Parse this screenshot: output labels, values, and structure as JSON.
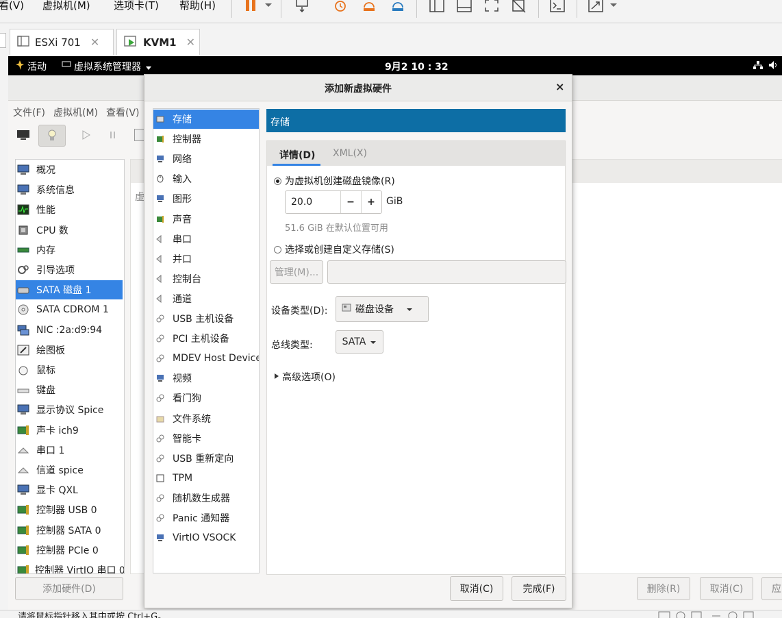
{
  "vmware": {
    "menus": [
      "看(V)",
      "虚拟机(M)",
      "选项卡(T)",
      "帮助(H)"
    ],
    "tabs": [
      {
        "label": "ESXi 701",
        "active": false
      },
      {
        "label": "KVM1",
        "active": true
      }
    ],
    "status_text": "请将鼠标指针移入其中或按 Ctrl+G。"
  },
  "gnome": {
    "activities": "活动",
    "app_menu": "虚拟系统管理器",
    "clock": "9月2 10 : 32"
  },
  "virt_manager": {
    "menus": [
      "文件(F)",
      "虚拟机(M)",
      "查看(V)"
    ],
    "sidebar": [
      {
        "label": "概况",
        "icon": "monitor-icon"
      },
      {
        "label": "系统信息",
        "icon": "monitor-icon"
      },
      {
        "label": "性能",
        "icon": "performance-icon"
      },
      {
        "label": "CPU 数",
        "icon": "cpu-icon"
      },
      {
        "label": "内存",
        "icon": "memory-icon"
      },
      {
        "label": "引导选项",
        "icon": "boot-options-icon"
      },
      {
        "label": "SATA 磁盘 1",
        "icon": "disk-icon",
        "selected": true
      },
      {
        "label": "SATA CDROM 1",
        "icon": "cdrom-icon"
      },
      {
        "label": "NIC :2a:d9:94",
        "icon": "network-icon"
      },
      {
        "label": "绘图板",
        "icon": "tablet-icon"
      },
      {
        "label": "鼠标",
        "icon": "mouse-icon"
      },
      {
        "label": "键盘",
        "icon": "keyboard-icon"
      },
      {
        "label": "显示协议 Spice",
        "icon": "monitor-icon"
      },
      {
        "label": "声卡 ich9",
        "icon": "sound-card-icon"
      },
      {
        "label": "串口 1",
        "icon": "serial-icon"
      },
      {
        "label": "信道 spice",
        "icon": "serial-icon"
      },
      {
        "label": "显卡 QXL",
        "icon": "monitor-icon"
      },
      {
        "label": "控制器 USB 0",
        "icon": "controller-icon"
      },
      {
        "label": "控制器 SATA 0",
        "icon": "controller-icon"
      },
      {
        "label": "控制器 PCIe 0",
        "icon": "controller-icon"
      },
      {
        "label": "控制器 VirtIO 串口 0",
        "icon": "controller-icon"
      }
    ],
    "add_hardware_button": "添加硬件(D)",
    "details_label": "虚",
    "remove_button": "删除(R)",
    "cancel_button": "取消(C)",
    "apply_button": "应"
  },
  "dialog": {
    "title": "添加新虚拟硬件",
    "close_glyph": "×",
    "hardware_list": [
      {
        "label": "存储",
        "selected": true
      },
      {
        "label": "控制器"
      },
      {
        "label": "网络"
      },
      {
        "label": "输入"
      },
      {
        "label": "图形"
      },
      {
        "label": "声音"
      },
      {
        "label": "串口"
      },
      {
        "label": "并口"
      },
      {
        "label": "控制台"
      },
      {
        "label": "通道"
      },
      {
        "label": "USB 主机设备"
      },
      {
        "label": "PCI 主机设备"
      },
      {
        "label": "MDEV Host Device"
      },
      {
        "label": "视频"
      },
      {
        "label": "看门狗"
      },
      {
        "label": "文件系统"
      },
      {
        "label": "智能卡"
      },
      {
        "label": "USB 重新定向"
      },
      {
        "label": "TPM"
      },
      {
        "label": "随机数生成器"
      },
      {
        "label": "Panic 通知器"
      },
      {
        "label": "VirtIO VSOCK"
      }
    ],
    "section_header": "存储",
    "tabs": [
      {
        "label": "详情(D)",
        "active": true
      },
      {
        "label": "XML(X)",
        "active": false
      }
    ],
    "create_image_radio": "为虚拟机创建磁盘镜像(R)",
    "size_value": "20.0",
    "minus": "−",
    "plus": "+",
    "size_unit": "GiB",
    "available_text": "51.6 GiB 在默认位置可用",
    "custom_storage_radio": "选择或创建自定义存储(S)",
    "manage_button": "管理(M)...",
    "storage_path_value": "",
    "device_type_label": "设备类型(D):",
    "device_type_value": "磁盘设备",
    "bus_type_label": "总线类型:",
    "bus_type_value": "SATA",
    "advanced_options": "高级选项(O)",
    "cancel_button": "取消(C)",
    "finish_button": "完成(F)"
  },
  "colors": {
    "accent": "#3584e4",
    "header_bar": "#0d6ea5",
    "gnome_bar": "#000000"
  }
}
